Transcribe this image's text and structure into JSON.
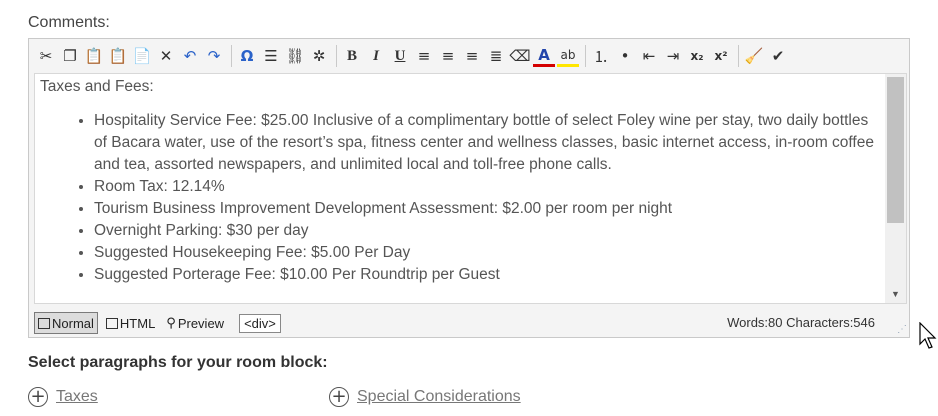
{
  "comments_label": "Comments:",
  "toolbar": {
    "buttons": [
      {
        "name": "cut-icon",
        "glyph": "✂"
      },
      {
        "name": "copy-icon",
        "glyph": "❐"
      },
      {
        "name": "paste-icon",
        "glyph": "📋"
      },
      {
        "name": "paste-text-icon",
        "glyph": "📋"
      },
      {
        "name": "paste-word-icon",
        "glyph": "📄"
      },
      {
        "name": "delete-icon",
        "glyph": "✕"
      },
      {
        "name": "undo-icon",
        "glyph": "↶"
      },
      {
        "name": "redo-icon",
        "glyph": "↷"
      },
      {
        "sep": true
      },
      {
        "name": "special-char-icon",
        "glyph": "Ω"
      },
      {
        "name": "horizontal-rule-icon",
        "glyph": "☰"
      },
      {
        "name": "link-icon",
        "glyph": "⛓"
      },
      {
        "name": "unlink-icon",
        "glyph": "✲"
      },
      {
        "sep": true
      },
      {
        "name": "bold-icon",
        "glyph": "B"
      },
      {
        "name": "italic-icon",
        "glyph": "I"
      },
      {
        "name": "underline-icon",
        "glyph": "U"
      },
      {
        "name": "align-left-icon",
        "glyph": "≡"
      },
      {
        "name": "align-center-icon",
        "glyph": "≡"
      },
      {
        "name": "align-right-icon",
        "glyph": "≡"
      },
      {
        "name": "justify-icon",
        "glyph": "≣"
      },
      {
        "name": "eraser-icon",
        "glyph": "⌫"
      },
      {
        "name": "font-color-icon",
        "glyph": "A"
      },
      {
        "name": "highlight-icon",
        "glyph": "ab"
      },
      {
        "sep": true
      },
      {
        "name": "ordered-list-icon",
        "glyph": "⒈"
      },
      {
        "name": "unordered-list-icon",
        "glyph": "•"
      },
      {
        "name": "outdent-icon",
        "glyph": "⇤"
      },
      {
        "name": "indent-icon",
        "glyph": "⇥"
      },
      {
        "name": "subscript-icon",
        "glyph": "x₂"
      },
      {
        "name": "superscript-icon",
        "glyph": "x²"
      },
      {
        "sep": true
      },
      {
        "name": "clean-icon",
        "glyph": "🧹"
      },
      {
        "name": "spellcheck-icon",
        "glyph": "✔"
      }
    ]
  },
  "content": {
    "heading": "Taxes and Fees:",
    "items": [
      "Hospitality Service Fee: $25.00 Inclusive of a complimentary bottle of select Foley wine per stay, two daily bottles of Bacara water, use of the resort’s spa, fitness center and wellness classes, basic internet access, in-room coffee and tea, assorted newspapers, and unlimited local and toll-free phone calls.",
      "Room Tax: 12.14%",
      "Tourism Business Improvement Development Assessment: $2.00 per room per night",
      "Overnight Parking: $30 per day",
      "Suggested Housekeeping Fee: $5.00 Per Day",
      "Suggested Porterage Fee: $10.00 Per Roundtrip per Guest"
    ]
  },
  "modes": {
    "normal": "Normal",
    "html": "HTML",
    "preview": "Preview"
  },
  "tag_path": "<div>",
  "counts": "Words:80 Characters:546",
  "section_title": "Select paragraphs for your room block:",
  "paragraph_links": {
    "taxes": "Taxes",
    "special": "Special Considerations"
  },
  "colors": {
    "font_color_underline": "#d40000",
    "highlight_underline": "#ffe600"
  }
}
